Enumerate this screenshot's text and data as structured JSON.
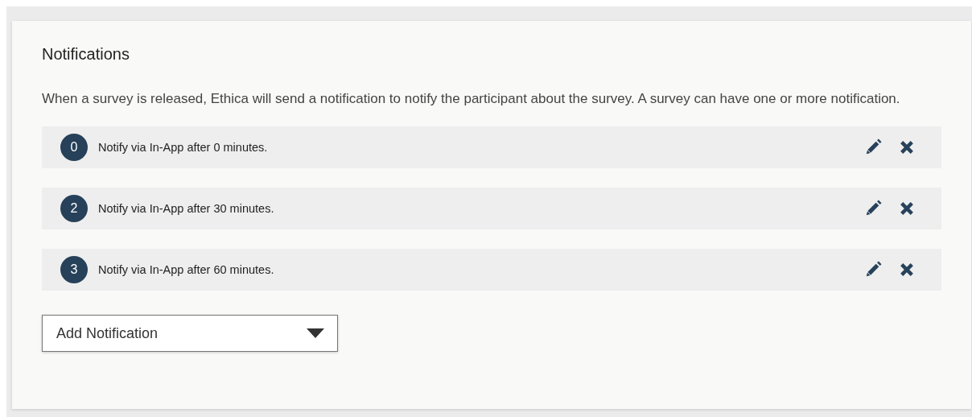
{
  "panel": {
    "title": "Notifications",
    "description": "When a survey is released, Ethica will send a notification to notify the participant about the survey. A survey can have one or more notification.",
    "notifications": [
      {
        "number": "0",
        "text": "Notify via In-App after 0 minutes."
      },
      {
        "number": "2",
        "text": "Notify via In-App after 30 minutes."
      },
      {
        "number": "3",
        "text": "Notify via In-App after 60 minutes."
      }
    ],
    "add_dropdown": {
      "value": "Add Notification"
    }
  }
}
